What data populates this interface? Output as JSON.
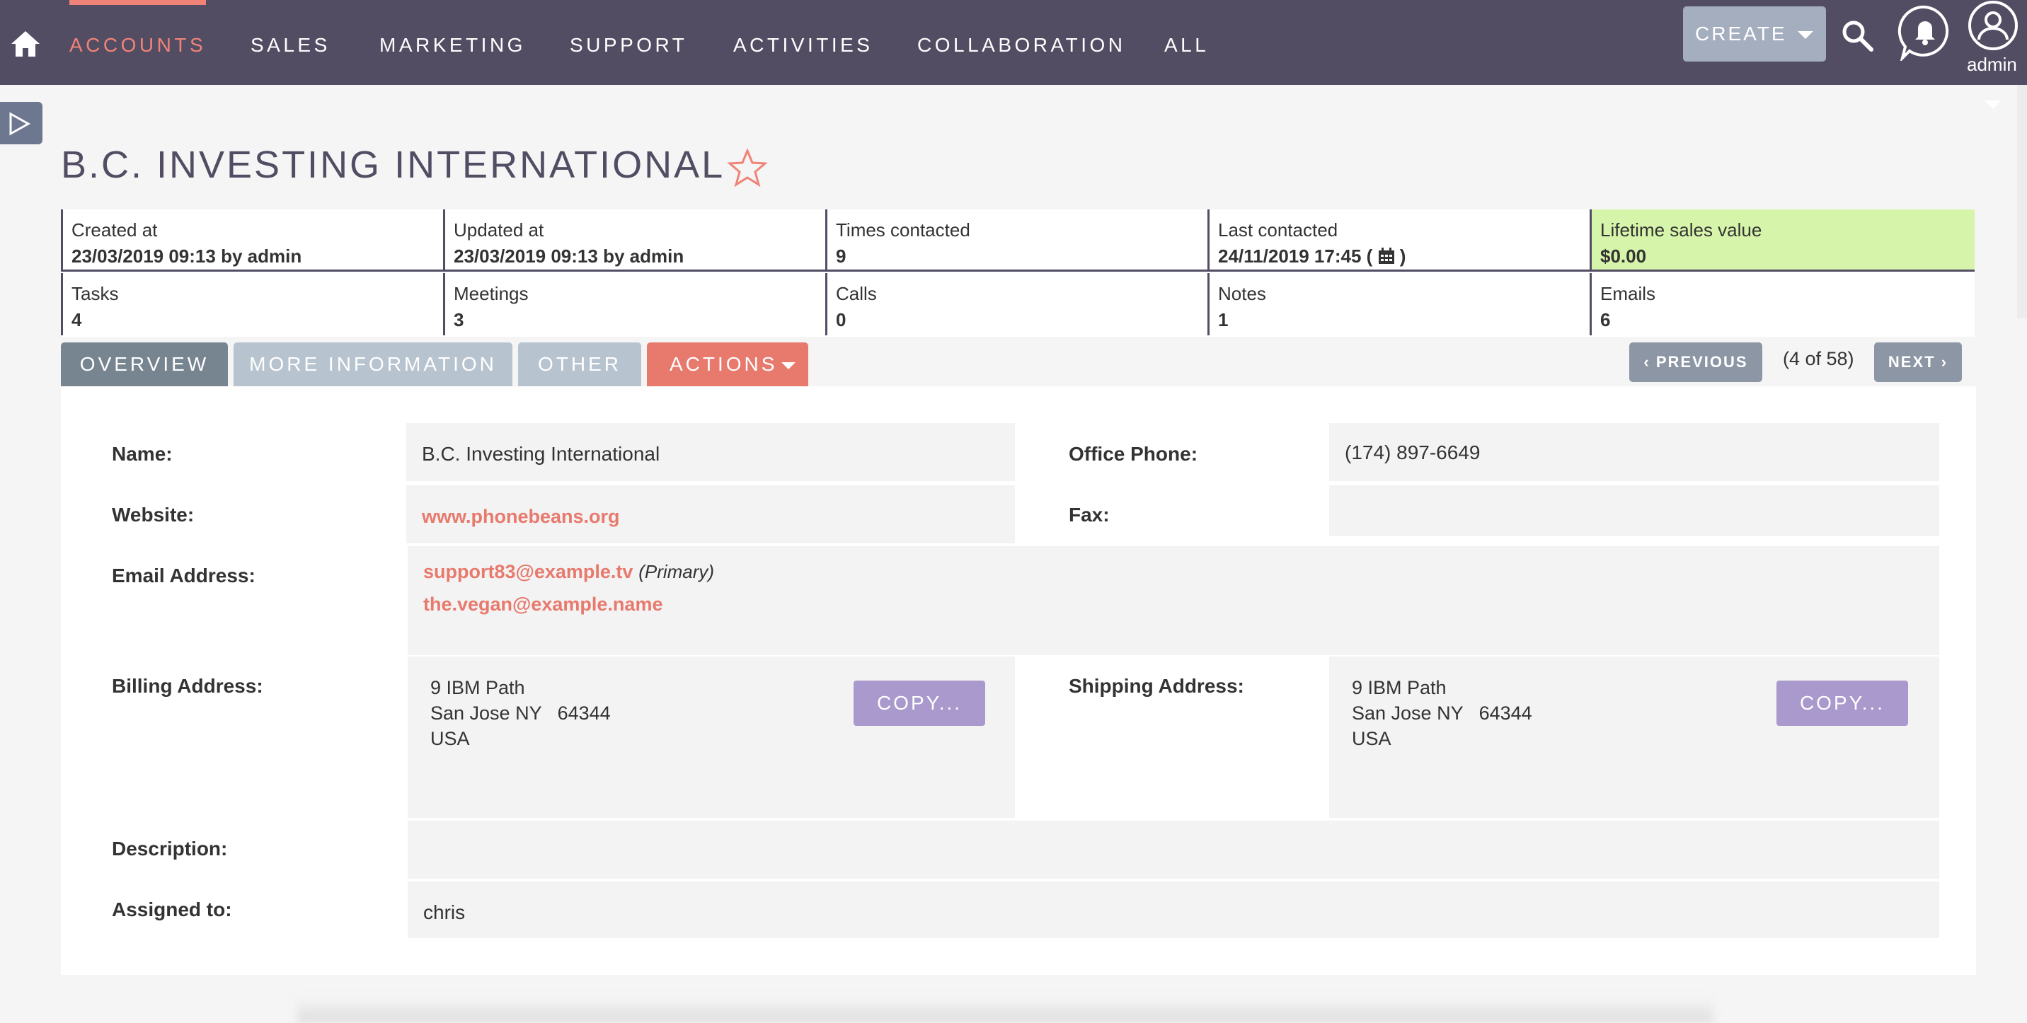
{
  "nav": {
    "items": [
      "ACCOUNTS",
      "SALES",
      "MARKETING",
      "SUPPORT",
      "ACTIVITIES",
      "COLLABORATION",
      "ALL"
    ],
    "active_index": 0,
    "create_label": "CREATE",
    "user_label": "admin"
  },
  "record": {
    "title": "B.C. INVESTING INTERNATIONAL"
  },
  "stats": [
    {
      "label": "Created at",
      "value": "23/03/2019 09:13 by admin"
    },
    {
      "label": "Updated at",
      "value": "23/03/2019 09:13 by admin"
    },
    {
      "label": "Times contacted",
      "value": "9"
    },
    {
      "label": "Last contacted",
      "value": "24/11/2019 17:45 (",
      "suffix": ")"
    },
    {
      "label": "Lifetime sales value",
      "value": "$0.00"
    },
    {
      "label": "Tasks",
      "value": "4"
    },
    {
      "label": "Meetings",
      "value": "3"
    },
    {
      "label": "Calls",
      "value": "0"
    },
    {
      "label": "Notes",
      "value": "1"
    },
    {
      "label": "Emails",
      "value": "6"
    }
  ],
  "tabs": [
    "OVERVIEW",
    "MORE INFORMATION",
    "OTHER",
    "ACTIONS"
  ],
  "pager": {
    "previous": "PREVIOUS",
    "count": "(4 of 58)",
    "next": "NEXT"
  },
  "fields": {
    "name_label": "Name:",
    "name_value": "B.C. Investing International",
    "office_phone_label": "Office Phone:",
    "office_phone_value": "(174) 897-6649",
    "website_label": "Website:",
    "website_value": "www.phonebeans.org",
    "fax_label": "Fax:",
    "fax_value": "",
    "email_label": "Email Address:",
    "email_primary": "support83@example.tv",
    "email_primary_tag": "(Primary)",
    "email_secondary": "the.vegan@example.name",
    "billing_label": "Billing Address:",
    "billing_lines": [
      "9 IBM Path",
      "San Jose NY   64344",
      "USA"
    ],
    "shipping_label": "Shipping Address:",
    "shipping_lines": [
      "9 IBM Path",
      "San Jose NY   64344",
      "USA"
    ],
    "copy_label": "COPY...",
    "description_label": "Description:",
    "description_value": "",
    "assigned_label": "Assigned to:",
    "assigned_value": "chris"
  },
  "colors": {
    "nav_bg": "#534d64",
    "accent": "#f08377",
    "lifetime_value_bg": "#d6f5aa",
    "copy_button": "#a999cc"
  },
  "icons": [
    "home-icon",
    "search-icon",
    "bell-icon",
    "user-icon",
    "star-icon",
    "calendar-icon",
    "sidebar-toggle-icon"
  ]
}
